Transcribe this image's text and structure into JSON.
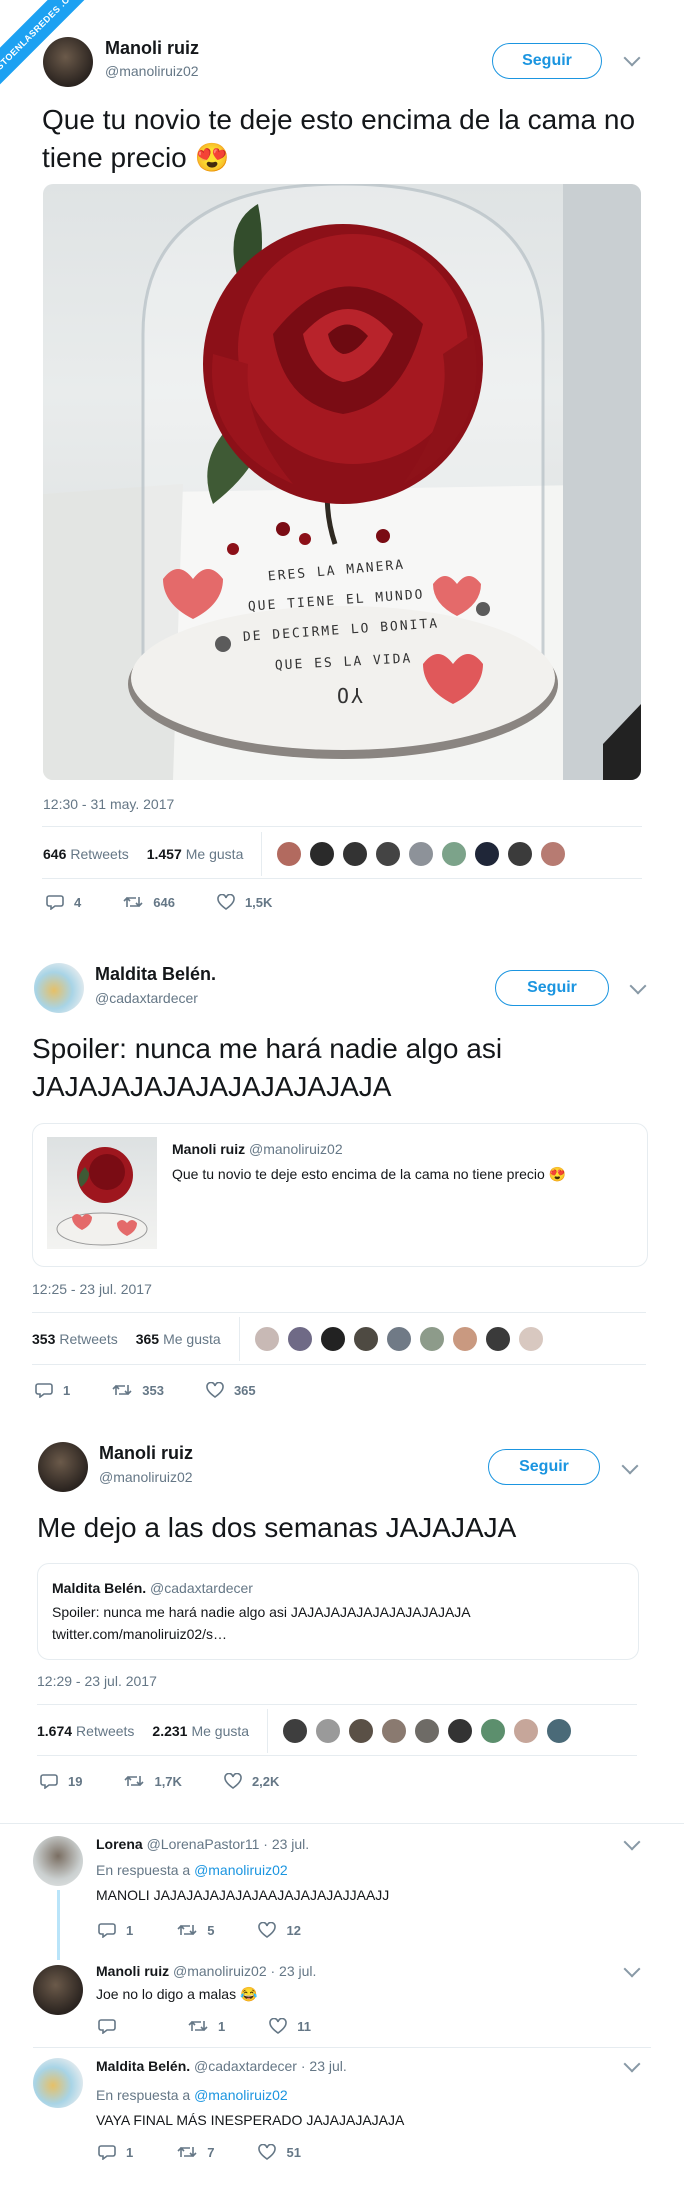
{
  "watermark": "VISTOENLASREDES .COM",
  "tweet1": {
    "author_name": "Manoli ruiz",
    "author_handle": "@manoliruiz02",
    "follow_label": "Seguir",
    "text": "Que tu novio te deje esto encima de la cama no tiene precio 😍",
    "image_note_lines": [
      "ERES LA MANERA",
      "QUE TIENE EL MUNDO",
      "DE DECIRME LO BONITA",
      "QUE ES LA VIDA",
      "YO"
    ],
    "timestamp": "12:30 - 31 may. 2017",
    "retweets_count": "646",
    "retweets_label": "Retweets",
    "likes_count": "1.457",
    "likes_label": "Me gusta",
    "replies": "4",
    "retweets": "646",
    "likes": "1,5K"
  },
  "tweet2": {
    "author_name": "Maldita Belén.",
    "author_handle": "@cadaxtardecer",
    "follow_label": "Seguir",
    "text": "Spoiler: nunca me hará nadie algo asi JAJAJAJAJAJAJAJAJAJAJA",
    "quote_author": "Manoli ruiz",
    "quote_handle": "@manoliruiz02",
    "quote_text": "Que tu novio te deje esto encima de la cama no tiene precio 😍",
    "timestamp": "12:25 - 23 jul. 2017",
    "retweets_count": "353",
    "retweets_label": "Retweets",
    "likes_count": "365",
    "likes_label": "Me gusta",
    "replies": "1",
    "retweets": "353",
    "likes": "365"
  },
  "tweet3": {
    "author_name": "Manoli ruiz",
    "author_handle": "@manoliruiz02",
    "follow_label": "Seguir",
    "text": "Me dejo a las dos semanas JAJAJAJA",
    "quote_author": "Maldita Belén.",
    "quote_handle": "@cadaxtardecer",
    "quote_text": "Spoiler: nunca me hará nadie algo asi JAJAJAJAJAJAJAJAJAJAJA",
    "quote_link": "twitter.com/manoliruiz02/s…",
    "timestamp": "12:29 - 23 jul. 2017",
    "retweets_count": "1.674",
    "retweets_label": "Retweets",
    "likes_count": "2.231",
    "likes_label": "Me gusta",
    "replies": "19",
    "retweets": "1,7K",
    "likes": "2,2K"
  },
  "replies": [
    {
      "author_name": "Lorena",
      "author_handle": "@LorenaPastor11 · 23 jul.",
      "reply_prefix": "En respuesta a",
      "reply_to": "@manoliruiz02",
      "text": "MANOLI JAJAJAJAJAJAJAAJAJAJAJAJJAAJJ",
      "replies": "1",
      "retweets": "5",
      "likes": "12"
    },
    {
      "author_name": "Manoli ruiz",
      "author_handle": "@manoliruiz02 · 23 jul.",
      "text": "Joe no lo digo a malas 😂",
      "replies": "",
      "retweets": "1",
      "likes": "11"
    },
    {
      "author_name": "Maldita Belén.",
      "author_handle": "@cadaxtardecer · 23 jul.",
      "reply_prefix": "En respuesta a",
      "reply_to": "@manoliruiz02",
      "text": "VAYA FINAL MÁS INESPERADO JAJAJAJAJAJA",
      "replies": "1",
      "retweets": "7",
      "likes": "51"
    }
  ],
  "colors": {
    "link": "#1b95e0",
    "muted": "#657786",
    "watermark": "#1da1f2",
    "border": "#e6ecf0"
  }
}
